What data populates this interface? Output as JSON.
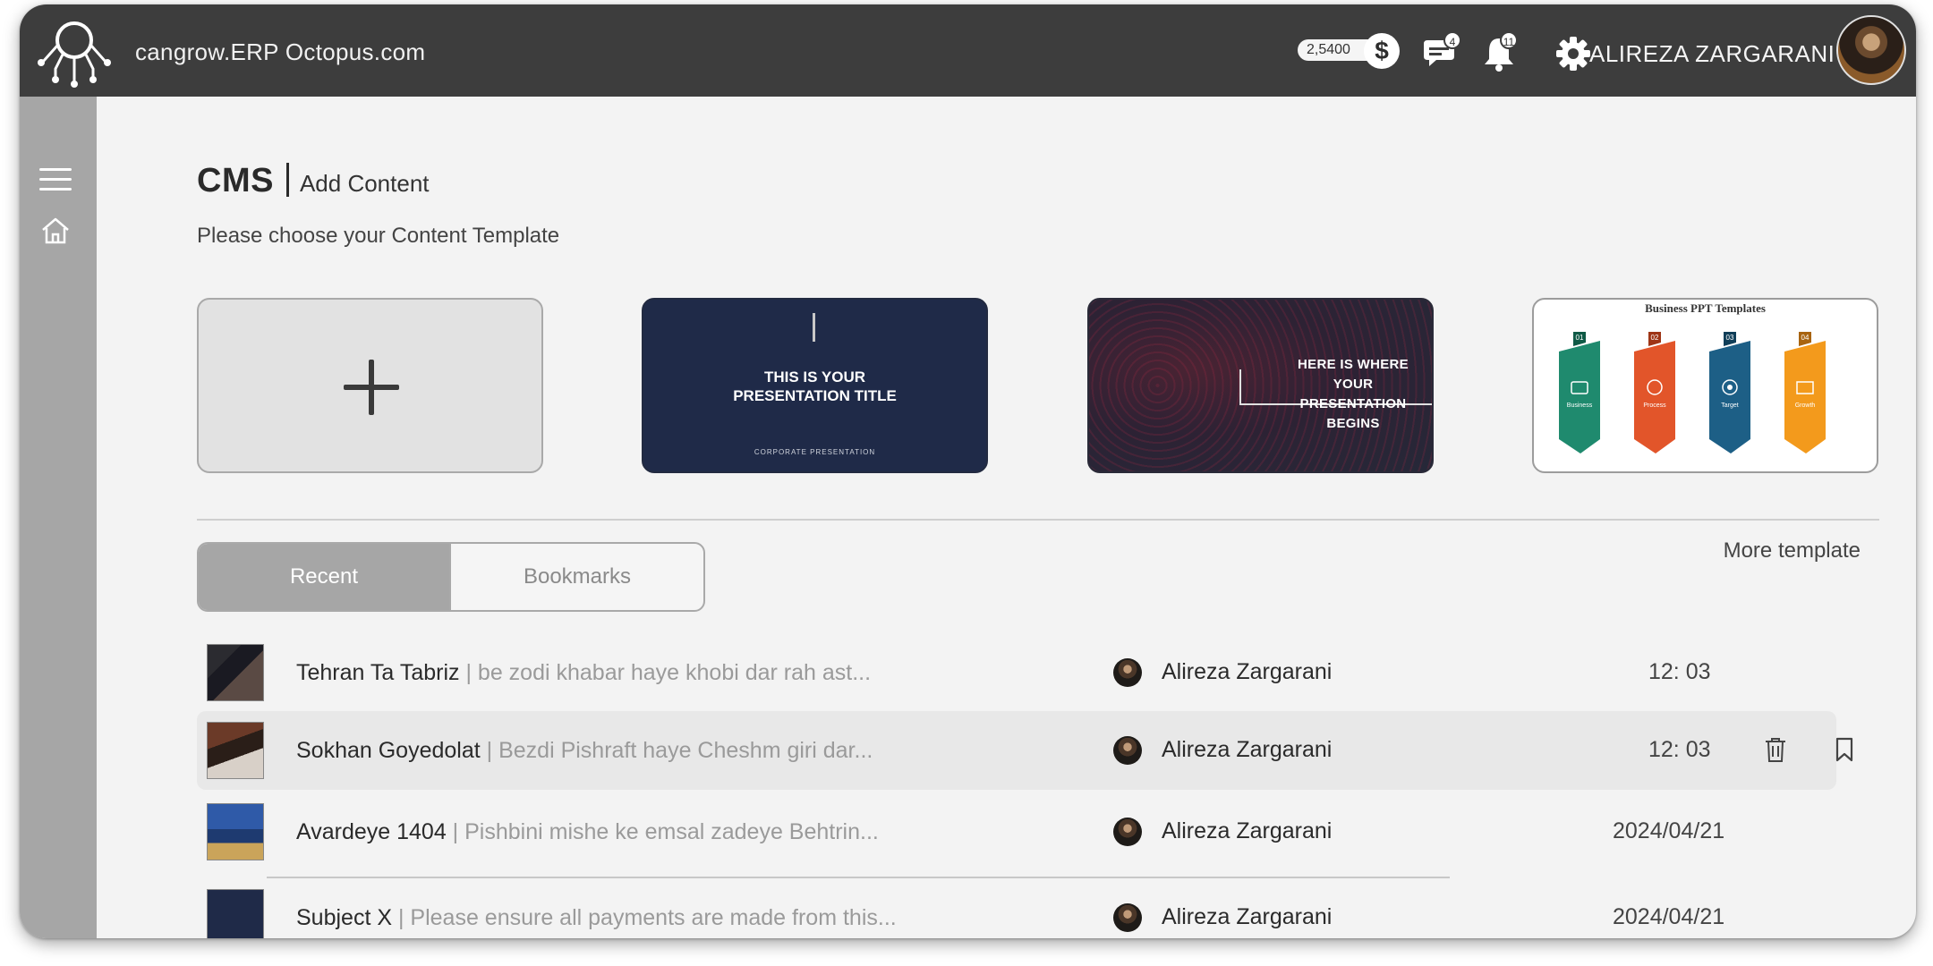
{
  "app": {
    "site_title": "cangrow.ERP Octopus.com",
    "credits": "2,5400",
    "dollar_symbol": "$",
    "messages_count": "4",
    "notifications_count": "11",
    "user_name": "ALIREZA ZARGARANI",
    "icons": [
      "octopus-logo-icon",
      "dollar-icon",
      "chat-icon",
      "bell-icon",
      "gear-icon",
      "hamburger-menu-icon",
      "home-icon",
      "trash-icon",
      "bookmark-icon"
    ]
  },
  "page": {
    "title": "CMS",
    "section": "Add Content",
    "subtitle": "Please choose your Content Template"
  },
  "templates": {
    "add_symbol": "+",
    "items": [
      {
        "line1": "THIS IS YOUR",
        "line2": "PRESENTATION TITLE",
        "footer": "CORPORATE PRESENTATION",
        "bg": "#1f2a48"
      },
      {
        "line1": "HERE IS WHERE YOUR",
        "line2": "PRESENTATION BEGINS",
        "bg": "#2d2234"
      },
      {
        "title": "Business PPT Templates",
        "steps": [
          "01",
          "02",
          "03",
          "04"
        ],
        "labels": [
          "Business",
          "Process",
          "Target",
          "Growth"
        ],
        "colors": [
          "#1f8a6e",
          "#e2552a",
          "#1d5f86",
          "#f39a1c"
        ]
      }
    ],
    "more_label": "More template"
  },
  "tabs": {
    "recent": "Recent",
    "bookmarks": "Bookmarks"
  },
  "rows": [
    {
      "title": "Tehran Ta Tabriz",
      "desc": " | be zodi khabar haye khobi dar rah ast...",
      "author": "Alireza Zargarani",
      "time": "12: 03"
    },
    {
      "title": "Sokhan Goyedolat",
      "desc": " | Bezdi Pishraft haye Cheshm giri dar...",
      "author": "Alireza Zargarani",
      "time": "12: 03"
    },
    {
      "title": "Avardeye 1404",
      "desc": " | Pishbini mishe ke emsal zadeye Behtrin...",
      "author": "Alireza Zargarani",
      "time": "2024/04/21"
    },
    {
      "title": "Subject X",
      "desc": " | Please ensure all payments are made from this...",
      "author": "Alireza Zargarani",
      "time": "2024/04/21"
    }
  ],
  "colors": {
    "topbar": "#3d3d3d",
    "sidebar": "#a6a6a6",
    "background": "#f3f3f3",
    "active_tab": "#a6a6a6"
  }
}
